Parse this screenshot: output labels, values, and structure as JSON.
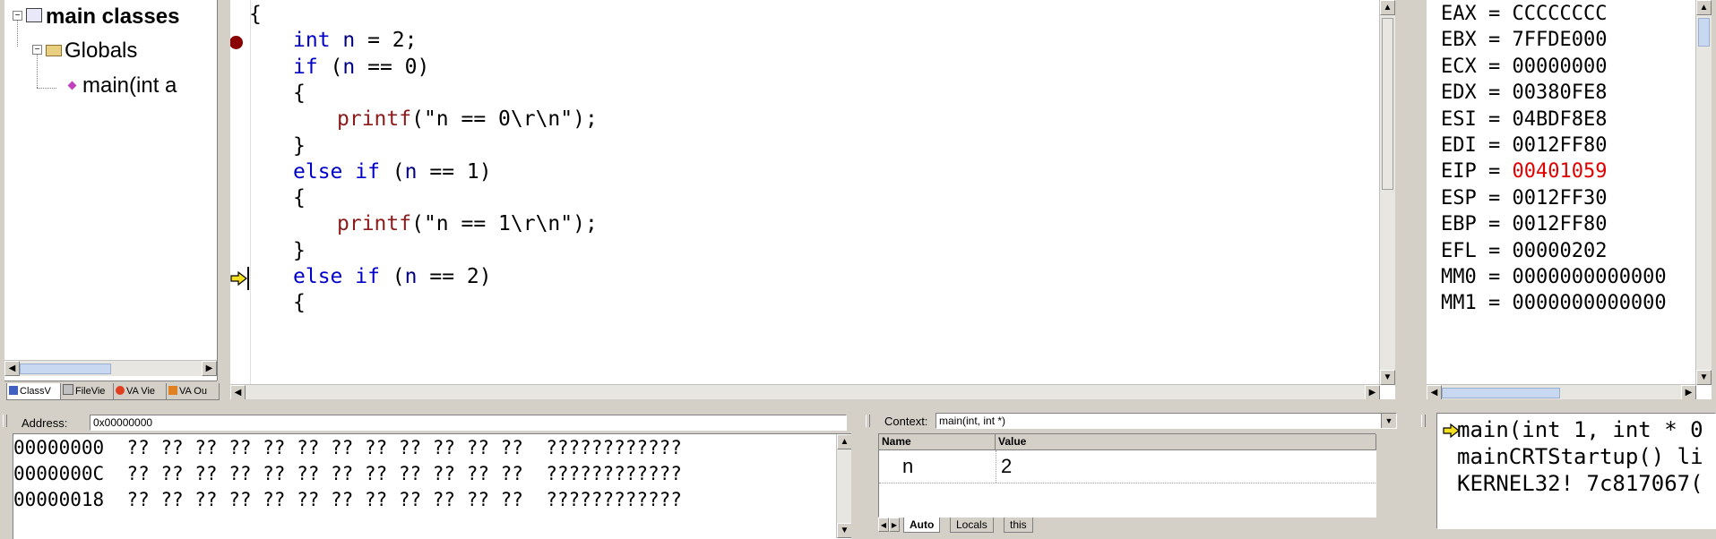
{
  "classview": {
    "root_label": "main classes",
    "globals_label": "Globals",
    "func_label": "main(int a",
    "tabs": [
      "ClassV",
      "FileVie",
      "VA Vie",
      "VA Ou"
    ]
  },
  "editor": {
    "lines": [
      {
        "indent": 0,
        "tokens": [
          {
            "t": "{",
            "c": "plain"
          }
        ]
      },
      {
        "indent": 1,
        "breakpoint": true,
        "tokens": [
          {
            "t": "int",
            "c": "kw"
          },
          {
            "t": " ",
            "c": "plain"
          },
          {
            "t": "n",
            "c": "id"
          },
          {
            "t": " = 2;",
            "c": "plain"
          }
        ]
      },
      {
        "indent": 1,
        "tokens": [
          {
            "t": "if",
            "c": "kw"
          },
          {
            "t": " (",
            "c": "plain"
          },
          {
            "t": "n",
            "c": "id"
          },
          {
            "t": " == 0)",
            "c": "plain"
          }
        ]
      },
      {
        "indent": 1,
        "tokens": [
          {
            "t": "{",
            "c": "plain"
          }
        ]
      },
      {
        "indent": 2,
        "tokens": [
          {
            "t": "printf",
            "c": "fn"
          },
          {
            "t": "(\"n == 0\\r\\n\");",
            "c": "plain"
          }
        ]
      },
      {
        "indent": 1,
        "tokens": [
          {
            "t": "}",
            "c": "plain"
          }
        ]
      },
      {
        "indent": 1,
        "tokens": [
          {
            "t": "else",
            "c": "kw"
          },
          {
            "t": " ",
            "c": "plain"
          },
          {
            "t": "if",
            "c": "kw"
          },
          {
            "t": " (",
            "c": "plain"
          },
          {
            "t": "n",
            "c": "id"
          },
          {
            "t": " == 1)",
            "c": "plain"
          }
        ]
      },
      {
        "indent": 1,
        "tokens": [
          {
            "t": "{",
            "c": "plain"
          }
        ]
      },
      {
        "indent": 2,
        "tokens": [
          {
            "t": "printf",
            "c": "fn"
          },
          {
            "t": "(\"n == 1\\r\\n\");",
            "c": "plain"
          }
        ]
      },
      {
        "indent": 1,
        "tokens": [
          {
            "t": "}",
            "c": "plain"
          }
        ]
      },
      {
        "indent": 1,
        "current": true,
        "tokens": [
          {
            "t": "else",
            "c": "kw"
          },
          {
            "t": " ",
            "c": "plain"
          },
          {
            "t": "if",
            "c": "kw"
          },
          {
            "t": " (",
            "c": "plain"
          },
          {
            "t": "n",
            "c": "id"
          },
          {
            "t": " == 2)",
            "c": "plain"
          }
        ]
      },
      {
        "indent": 1,
        "tokens": [
          {
            "t": "{",
            "c": "plain"
          }
        ]
      }
    ]
  },
  "registers": [
    {
      "name": "EAX",
      "value": "CCCCCCCC"
    },
    {
      "name": "EBX",
      "value": "7FFDE000"
    },
    {
      "name": "ECX",
      "value": "00000000"
    },
    {
      "name": "EDX",
      "value": "00380FE8"
    },
    {
      "name": "ESI",
      "value": "04BDF8E8"
    },
    {
      "name": "EDI",
      "value": "0012FF80"
    },
    {
      "name": "EIP",
      "value": "00401059",
      "changed": true
    },
    {
      "name": "ESP",
      "value": "0012FF30"
    },
    {
      "name": "EBP",
      "value": "0012FF80"
    },
    {
      "name": "EFL",
      "value": "00000202"
    },
    {
      "name": "MM0",
      "value": "0000000000000"
    },
    {
      "name": "MM1",
      "value": "0000000000000"
    }
  ],
  "memory": {
    "address_label": "Address:",
    "address_value": "0x00000000",
    "rows": [
      {
        "addr": "00000000",
        "bytes": "?? ?? ?? ?? ?? ?? ?? ?? ?? ?? ?? ??",
        "ascii": "????????????"
      },
      {
        "addr": "0000000C",
        "bytes": "?? ?? ?? ?? ?? ?? ?? ?? ?? ?? ?? ??",
        "ascii": "????????????"
      },
      {
        "addr": "00000018",
        "bytes": "?? ?? ?? ?? ?? ?? ?? ?? ?? ?? ?? ??",
        "ascii": "????????????"
      }
    ]
  },
  "watch": {
    "context_label": "Context:",
    "context_value": "main(int, int *)",
    "col_name": "Name",
    "col_value": "Value",
    "rows": [
      {
        "name": "n",
        "value": "2"
      }
    ],
    "tabs": [
      "Auto",
      "Locals",
      "this"
    ]
  },
  "callstack": {
    "frames": [
      "main(int 1, int * 0",
      "mainCRTStartup() li",
      "KERNEL32! 7c817067("
    ]
  }
}
